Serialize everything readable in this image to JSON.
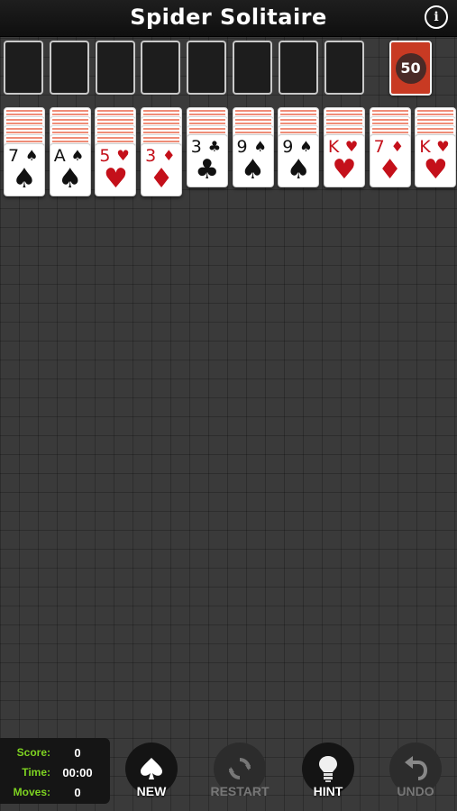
{
  "header": {
    "title": "Spider Solitaire",
    "info_icon": "info-icon"
  },
  "foundation_slots": 8,
  "stock": {
    "count": "50"
  },
  "tableau": [
    {
      "face_down": 4,
      "card": {
        "rank": "7",
        "suit": "♠",
        "color": "black"
      }
    },
    {
      "face_down": 4,
      "card": {
        "rank": "A",
        "suit": "♠",
        "color": "black"
      }
    },
    {
      "face_down": 4,
      "card": {
        "rank": "5",
        "suit": "♥",
        "color": "red"
      }
    },
    {
      "face_down": 4,
      "card": {
        "rank": "3",
        "suit": "♦",
        "color": "red"
      }
    },
    {
      "face_down": 3,
      "card": {
        "rank": "3",
        "suit": "♣",
        "color": "black"
      }
    },
    {
      "face_down": 3,
      "card": {
        "rank": "9",
        "suit": "♠",
        "color": "black"
      }
    },
    {
      "face_down": 3,
      "card": {
        "rank": "9",
        "suit": "♠",
        "color": "black"
      }
    },
    {
      "face_down": 3,
      "card": {
        "rank": "K",
        "suit": "♥",
        "color": "red"
      }
    },
    {
      "face_down": 3,
      "card": {
        "rank": "7",
        "suit": "♦",
        "color": "red"
      }
    },
    {
      "face_down": 3,
      "card": {
        "rank": "K",
        "suit": "♥",
        "color": "red"
      }
    }
  ],
  "stats": {
    "score_label": "Score:",
    "score": "0",
    "time_label": "Time:",
    "time": "00:00",
    "moves_label": "Moves:",
    "moves": "0"
  },
  "controls": {
    "new_label": "NEW",
    "restart_label": "RESTART",
    "hint_label": "HINT",
    "undo_label": "UNDO"
  },
  "colors": {
    "accent_green": "#7ed321",
    "card_red": "#c4101a",
    "stock_red": "#c83a23"
  }
}
